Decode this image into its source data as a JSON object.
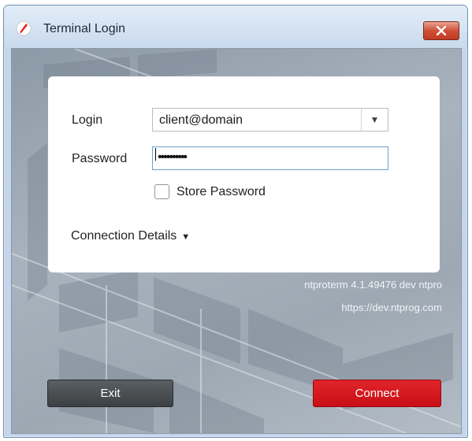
{
  "window": {
    "title": "Terminal Login",
    "brand_color": "#e0282e"
  },
  "icons": {
    "app": "app-logo-icon",
    "close": "close-icon",
    "dropdown": "chevron-down-icon",
    "expand": "triangle-down-icon"
  },
  "form": {
    "login_label": "Login",
    "login_value": "client@domain",
    "password_label": "Password",
    "password_value": "••••••••••",
    "store_password_label": "Store Password",
    "store_password_checked": false,
    "connection_details_label": "Connection Details"
  },
  "info": {
    "version": "ntproterm 4.1.49476 dev ntpro",
    "url": "https://dev.ntprog.com"
  },
  "actions": {
    "exit_label": "Exit",
    "connect_label": "Connect"
  }
}
